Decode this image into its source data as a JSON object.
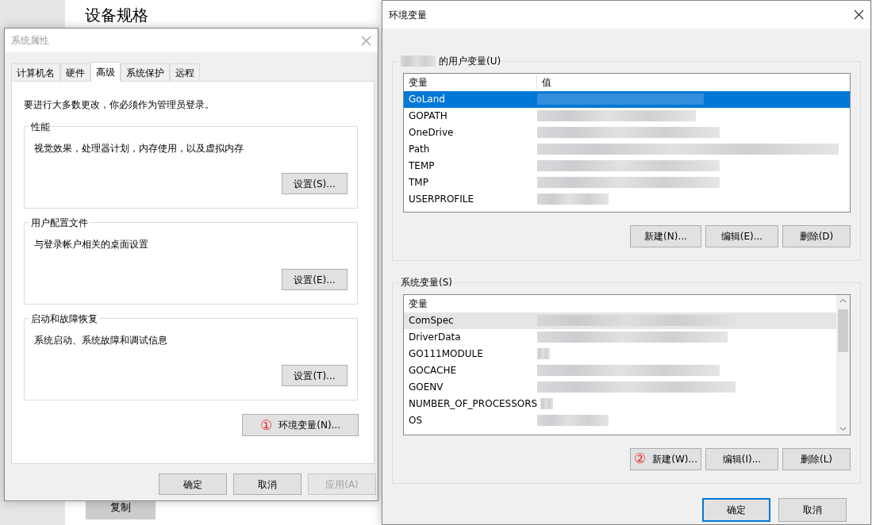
{
  "background": {
    "heading": "设备规格",
    "button": "复制"
  },
  "system_properties": {
    "title": "系统属性",
    "tabs": [
      {
        "label": "计算机名",
        "selected": false
      },
      {
        "label": "硬件",
        "selected": false
      },
      {
        "label": "高级",
        "selected": true
      },
      {
        "label": "系统保护",
        "selected": false
      },
      {
        "label": "远程",
        "selected": false
      }
    ],
    "admin_note": "要进行大多数更改，你必须作为管理员登录。",
    "groups": [
      {
        "title": "性能",
        "description": "视觉效果，处理器计划，内存使用，以及虚拟内存",
        "button": "设置(S)..."
      },
      {
        "title": "用户配置文件",
        "description": "与登录帐户相关的桌面设置",
        "button": "设置(E)..."
      },
      {
        "title": "启动和故障恢复",
        "description": "系统启动、系统故障和调试信息",
        "button": "设置(T)..."
      }
    ],
    "env_button": {
      "label": "环境变量(N)...",
      "annotation": "①"
    },
    "buttons": [
      {
        "label": "确定",
        "disabled": false
      },
      {
        "label": "取消",
        "disabled": false
      },
      {
        "label": "应用(A)",
        "disabled": true
      }
    ]
  },
  "environment_variables": {
    "title": "环境变量",
    "user_group": {
      "title": "的用户变量(U)",
      "columns": [
        "变量",
        "值"
      ],
      "rows": [
        {
          "name": "GoLand",
          "selected": true,
          "highlighted": false
        },
        {
          "name": "GOPATH",
          "selected": false,
          "highlighted": false
        },
        {
          "name": "OneDrive",
          "selected": false,
          "highlighted": false
        },
        {
          "name": "Path",
          "selected": false,
          "highlighted": false
        },
        {
          "name": "TEMP",
          "selected": false,
          "highlighted": false
        },
        {
          "name": "TMP",
          "selected": false,
          "highlighted": false
        },
        {
          "name": "USERPROFILE",
          "selected": false,
          "highlighted": false
        }
      ],
      "buttons": [
        {
          "label": "新建(N)..."
        },
        {
          "label": "编辑(E)..."
        },
        {
          "label": "删除(D)"
        }
      ]
    },
    "system_group": {
      "title": "系统变量(S)",
      "columns": [
        "变量"
      ],
      "rows": [
        {
          "name": "ComSpec",
          "selected": false,
          "highlighted": true
        },
        {
          "name": "DriverData",
          "selected": false,
          "highlighted": false
        },
        {
          "name": "GO111MODULE",
          "selected": false,
          "highlighted": false
        },
        {
          "name": "GOCACHE",
          "selected": false,
          "highlighted": false
        },
        {
          "name": "GOENV",
          "selected": false,
          "highlighted": false
        },
        {
          "name": "NUMBER_OF_PROCESSORS",
          "selected": false,
          "highlighted": false
        },
        {
          "name": "OS",
          "selected": false,
          "highlighted": false
        }
      ],
      "buttons": [
        {
          "label": "新建(W)...",
          "annotation": "②"
        },
        {
          "label": "编辑(I)..."
        },
        {
          "label": "删除(L)"
        }
      ]
    },
    "buttons": [
      {
        "label": "确定",
        "default": true
      },
      {
        "label": "取消",
        "default": false
      }
    ]
  }
}
